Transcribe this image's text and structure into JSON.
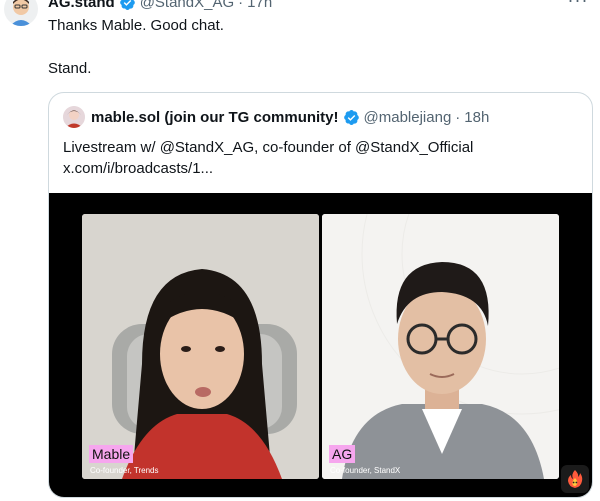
{
  "tweet": {
    "author_name": "AG.stand",
    "handle": "@StandX_AG",
    "time": "17h",
    "separator": "·",
    "more_label": "···",
    "lines": [
      "Thanks Mable. Good chat.",
      "Stand."
    ]
  },
  "quote": {
    "author_name": "mable.sol (join our TG community!",
    "handle": "@mablejiang",
    "time": "18h",
    "separator": "·",
    "text": "Livestream w/ @StandX_AG, co-founder of @StandX_Official",
    "link": "x.com/i/broadcasts/1..."
  },
  "media": {
    "left": {
      "name": "Mable",
      "subtitle": "Co-founder, Trends"
    },
    "right": {
      "name": "AG",
      "subtitle": "Co-founder, StandX"
    },
    "reaction_icon": "fire-icon"
  },
  "colors": {
    "verified": "#1d9bf0",
    "name_tag": "#f6a6ee",
    "secondary_text": "#536471",
    "border": "#cfd9de"
  }
}
